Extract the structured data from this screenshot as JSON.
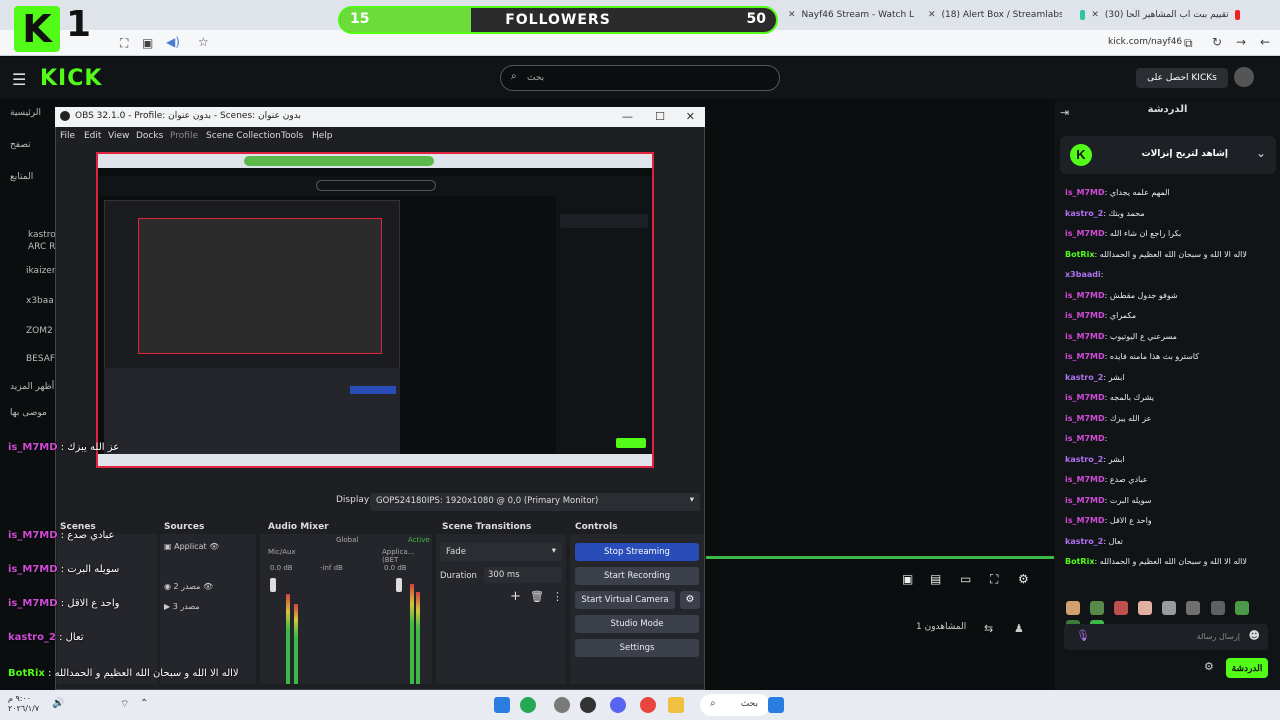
{
  "browser": {
    "tabs": [
      {
        "label": "Nayf46 Stream - Watch Live on",
        "color": "#53fc18"
      },
      {
        "label": "(18) Alert Box / Streamlabs",
        "color": "#31c3a2"
      },
      {
        "label": "(30) تقييم ببت اب المشاهير الحا",
        "color": "#e22"
      }
    ],
    "url": "kick.com/nayf46"
  },
  "overlay_logo": {
    "letter": "K",
    "number": "1"
  },
  "followers": {
    "current": "15",
    "title": "FOLLOWERS",
    "goal": "50",
    "progress": 0.3
  },
  "kick": {
    "brand": "KICK",
    "search_placeholder": "بحث",
    "get_kicks": "احصل على KICKs",
    "sidebar": [
      "الرئيسية",
      "تصفح",
      "المتابع",
      "kastro",
      "ARC R",
      "ikaizer",
      "x3baa",
      "ZOM2",
      "BESAF",
      "أظهر المزيد",
      "موصى بها"
    ]
  },
  "obs": {
    "title": "OBS 32.1.0 - Profile: بدون عنوان - Scenes: بدون عنوان",
    "menu": [
      "File",
      "Edit",
      "View",
      "Docks",
      "Profile",
      "Scene Collection",
      "Tools",
      "Help"
    ],
    "display_label": "Display",
    "display_value": "GOPS24180IPS: 1920x1080 @ 0,0 (Primary Monitor)",
    "docks": {
      "scenes": "Scenes",
      "sources": "Sources",
      "audio": "Audio Mixer",
      "transitions": "Scene Transitions",
      "controls": "Controls"
    },
    "sources": [
      "Applicat",
      "مصدر 2",
      "مصدر 3"
    ],
    "audio": {
      "mic": "Mic/Aux",
      "app": "Applica... (BET",
      "global": "Global",
      "active": "Active",
      "vol1": "0.0 dB",
      "vol2": "-inf dB",
      "vol3": "0.0 dB"
    },
    "transition": {
      "value": "Fade",
      "duration_label": "Duration",
      "duration_value": "300 ms"
    },
    "controls": [
      "Stop Streaming",
      "Start Recording",
      "Start Virtual Camera",
      "Studio Mode",
      "Settings"
    ]
  },
  "overlay_chat": [
    {
      "user": "is_M7MD",
      "text": "عز الله يبزك"
    },
    {
      "user": "is_M7MD",
      "text": "عبادي صدع"
    },
    {
      "user": "is_M7MD",
      "text": "سويله البرت"
    },
    {
      "user": "is_M7MD",
      "text": "واحد ع الاقل"
    },
    {
      "user": "kastro_2",
      "text": "تعال"
    },
    {
      "user": "BotRix",
      "text": "لااله الا الله و سبحان الله العظيم و الحمدالله"
    }
  ],
  "chat": {
    "title": "الدردشة",
    "pinned": "إشاهد لتربح إنزالات",
    "messages": [
      {
        "user": "is_M7MD",
        "text": "المهم علمه يجداي",
        "color": "#d14cd6"
      },
      {
        "user": "kastro_2",
        "text": "محمد وبتك",
        "color": "#b072f0"
      },
      {
        "user": "is_M7MD",
        "text": "بكرا راجع ان شاء الله",
        "color": "#d14cd6"
      },
      {
        "user": "BotRix",
        "text": "لااله الا الله و سبحان الله العظيم و الحمدالله",
        "color": "#53fc18"
      },
      {
        "user": "x3baadi",
        "text": "",
        "color": "#b072f0"
      },
      {
        "user": "is_M7MD",
        "text": "شوفو جدول مقطش",
        "color": "#d14cd6"
      },
      {
        "user": "is_M7MD",
        "text": "مكمراي",
        "color": "#d14cd6"
      },
      {
        "user": "is_M7MD",
        "text": "مسرعني ع اليوتيوب",
        "color": "#d14cd6"
      },
      {
        "user": "is_M7MD",
        "text": "كاسترو بث هذا مامنه فايده",
        "color": "#d14cd6"
      },
      {
        "user": "kastro_2",
        "text": "ابشر",
        "color": "#b072f0"
      },
      {
        "user": "is_M7MD",
        "text": "يشرك بالمجه",
        "color": "#d14cd6"
      },
      {
        "user": "is_M7MD",
        "text": "عز الله يبزك",
        "color": "#d14cd6"
      },
      {
        "user": "is_M7MD",
        "text": "",
        "color": "#d14cd6"
      },
      {
        "user": "kastro_2",
        "text": "ابشر",
        "color": "#b072f0"
      },
      {
        "user": "is_M7MD",
        "text": "عبادي صدع",
        "color": "#d14cd6"
      },
      {
        "user": "is_M7MD",
        "text": "سويله البرت",
        "color": "#d14cd6"
      },
      {
        "user": "is_M7MD",
        "text": "واحد ع الاقل",
        "color": "#d14cd6"
      },
      {
        "user": "kastro_2",
        "text": "تعال",
        "color": "#b072f0"
      },
      {
        "user": "BotRix",
        "text": "لااله الا الله و سبحان الله العظيم و الحمدالله",
        "color": "#53fc18"
      }
    ],
    "input_placeholder": "إرسال رسالة",
    "send": "الدردشة"
  },
  "viewers": "المشاهدون 1",
  "taskbar": {
    "search": "بحث",
    "time": "٩:٠٠ م",
    "date": "٢٠٢٦/١/٧"
  }
}
